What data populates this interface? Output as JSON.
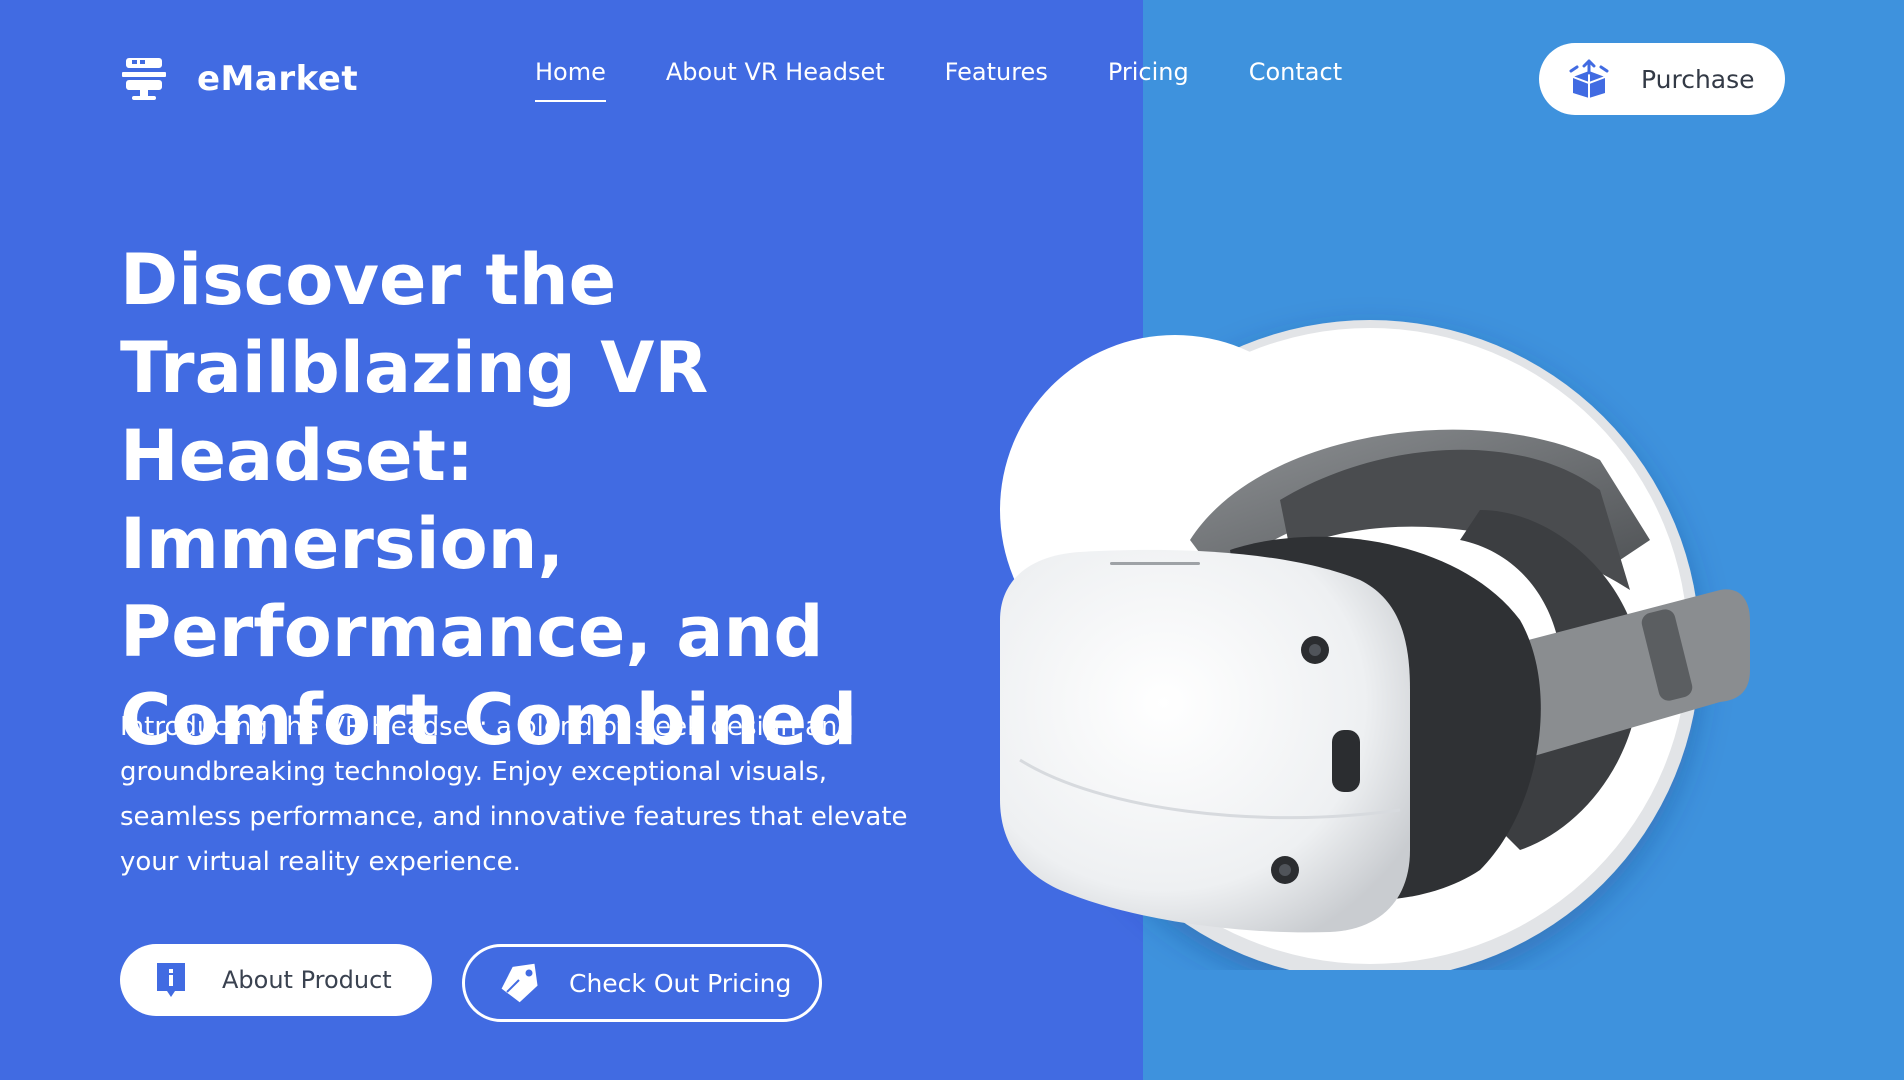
{
  "brand": {
    "name": "eMarket",
    "icon": "monitor-icon"
  },
  "nav": {
    "items": [
      {
        "label": "Home",
        "active": true
      },
      {
        "label": "About VR Headset",
        "active": false
      },
      {
        "label": "Features",
        "active": false
      },
      {
        "label": "Pricing",
        "active": false
      },
      {
        "label": "Contact",
        "active": false
      }
    ]
  },
  "header": {
    "purchase_label": "Purchase",
    "purchase_icon": "box-icon"
  },
  "hero": {
    "title": "Discover the Trailblazing VR Headset: Immersion, Performance, and Comfort Combined",
    "description": "Introducing the VR Headset: a blend of sleek design and groundbreaking technology. Enjoy exceptional visuals, seamless performance, and innovative features that elevate your virtual reality experience.",
    "about_button": {
      "label": "About Product",
      "icon": "info-icon"
    },
    "pricing_button": {
      "label": "Check Out Pricing",
      "icon": "tag-icon"
    }
  },
  "colors": {
    "left_panel": "#416be2",
    "right_panel": "#3e92dd",
    "accent_icon": "#416be2"
  },
  "image": {
    "subject": "vr-headset"
  }
}
